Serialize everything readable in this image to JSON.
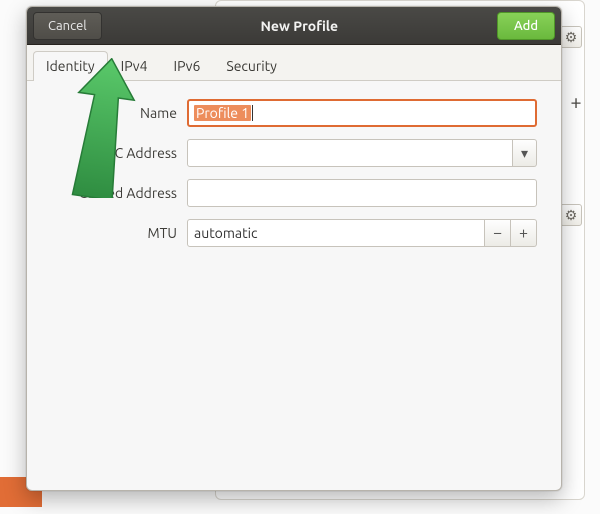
{
  "header": {
    "cancel_label": "Cancel",
    "title": "New Profile",
    "add_label": "Add"
  },
  "tabs": {
    "identity": "Identity",
    "ipv4": "IPv4",
    "ipv6": "IPv6",
    "security": "Security",
    "active": "identity"
  },
  "form": {
    "name_label": "Name",
    "name_value": "Profile 1",
    "mac_label": "MAC Address",
    "mac_value": "",
    "cloned_label": "Cloned Address",
    "cloned_value": "",
    "mtu_label": "MTU",
    "mtu_value": "automatic"
  },
  "icons": {
    "dropdown": "▾",
    "minus": "−",
    "plus": "+",
    "gear": "⚙"
  }
}
